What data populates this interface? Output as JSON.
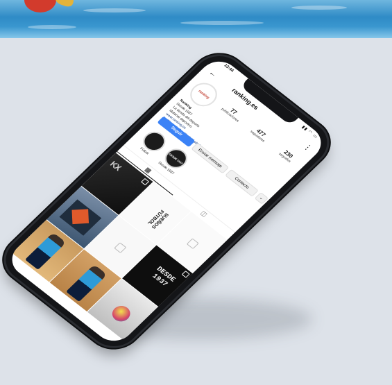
{
  "status_bar": {
    "time": "13:44",
    "icons": "▮▮ ◠ ▭"
  },
  "header": {
    "back_icon": "arrow-left-icon",
    "username": "ranking.es",
    "menu_icon": "more-icon"
  },
  "profile": {
    "avatar_text": "ranking",
    "stats": [
      {
        "value": "77",
        "label": "publicaciones"
      },
      {
        "value": "477",
        "label": "seguidores"
      },
      {
        "value": "230",
        "label": "seguidos"
      }
    ]
  },
  "bio": {
    "name": "Ranking",
    "lines": [
      "Desde 1937",
      "La tienda del deporte",
      "Material deportivo"
    ],
    "links": [
      "www.ranking.es",
      "Av. Plaza de Castilla 3, Madrid"
    ]
  },
  "buttons": {
    "follow": "Seguir",
    "message": "Enviar mensaje",
    "contact": "Contacto",
    "more": "⌄"
  },
  "highlights": [
    {
      "label": "Fútbol",
      "circle_text": ""
    },
    {
      "label": "Desde 1937",
      "circle_text": "DESDE 1937"
    }
  ],
  "tabs": {
    "grid_icon": "grid-icon",
    "tagged_icon": "tagged-icon"
  },
  "posts": [
    {
      "text": "KX"
    },
    {
      "text": "SUEÑOS FÚTBOL"
    },
    {
      "text": ""
    },
    {
      "text": ""
    },
    {
      "text": ""
    },
    {
      "text": "DESDE 1937"
    },
    {
      "text": ""
    },
    {
      "text": ""
    },
    {
      "text": ""
    }
  ],
  "colors": {
    "accent": "#3b82f6",
    "background": "#dde2e9",
    "phone_body": "#141518"
  }
}
